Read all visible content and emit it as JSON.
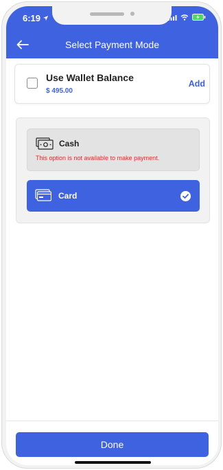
{
  "status_bar": {
    "time": "6:19"
  },
  "header": {
    "title": "Select Payment Mode"
  },
  "wallet": {
    "label": "Use Wallet Balance",
    "amount": "$ 495.00",
    "add_label": "Add"
  },
  "options": {
    "cash": {
      "label": "Cash",
      "message": "This option is not available to make payment."
    },
    "card": {
      "label": "Card",
      "selected": true
    }
  },
  "footer": {
    "done_label": "Done"
  },
  "colors": {
    "primary": "#3f63e0",
    "error": "#e02a2a",
    "disabled_bg": "#e3e3e3"
  },
  "icons": [
    "location-arrow-icon",
    "signal-icon",
    "wifi-icon",
    "battery-icon",
    "back-arrow-icon",
    "cash-icon",
    "card-icon",
    "check-circle-icon"
  ]
}
